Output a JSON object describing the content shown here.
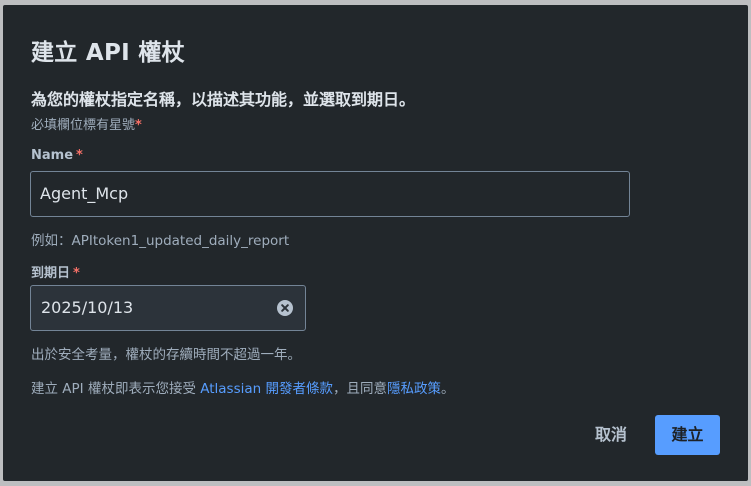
{
  "dialog": {
    "title": "建立 API 權杖",
    "subtitle": "為您的權杖指定名稱，以描述其功能，並選取到期日。",
    "required_note": "必填欄位標有星號",
    "required_mark": "*"
  },
  "name_field": {
    "label": "Name",
    "value": "Agent_Mcp",
    "helper": "例如：APItoken1_updated_daily_report"
  },
  "expiry_field": {
    "label": "到期日",
    "value": "2025/10/13",
    "helper": "出於安全考量，權杖的存續時間不超過一年。",
    "clear_icon": "clear-circle-x"
  },
  "terms": {
    "prefix": "建立 API 權杖即表示您接受 ",
    "link_terms": "Atlassian 開發者條款",
    "middle": "，且同意",
    "link_privacy": "隱私政策",
    "suffix": "。"
  },
  "actions": {
    "cancel_label": "取消",
    "create_label": "建立"
  },
  "colors": {
    "dialog_bg": "#22272b",
    "accent": "#579dff",
    "required": "#f87168"
  }
}
